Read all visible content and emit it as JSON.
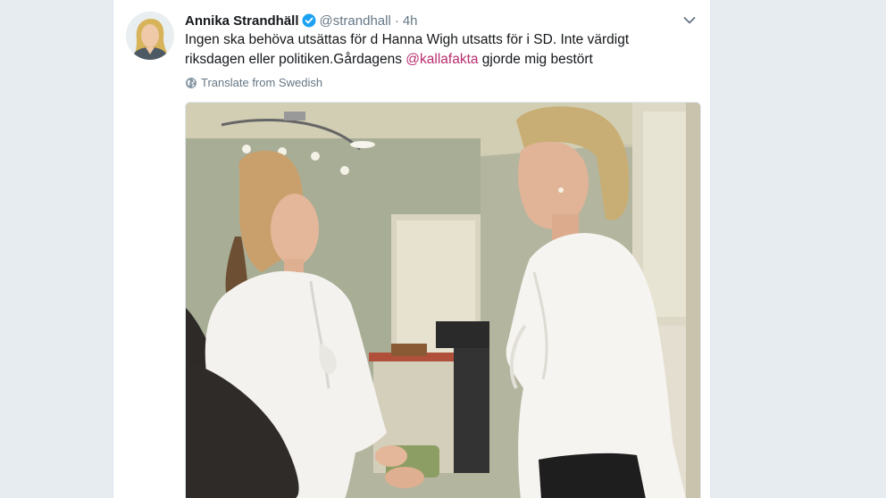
{
  "tweet": {
    "author_name": "Annika Strandhäll",
    "handle": "@strandhall",
    "separator": "·",
    "time": "4h",
    "text_part1": "Ingen ska behöva utsättas för d Hanna Wigh utsatts för i SD. Inte värdigt riksdagen eller politiken.Gårdagens ",
    "mention": "@kallafakta",
    "text_part2": " gjorde mig bestört",
    "translate_label": "Translate from Swedish"
  },
  "icons": {
    "verified": "verified-badge-icon",
    "caret": "chevron-down-icon",
    "globe": "globe-icon"
  },
  "colors": {
    "background": "#e6ecf0",
    "card": "#ffffff",
    "mention": "#b72e6e",
    "verified": "#1da1f2",
    "muted": "#657786"
  }
}
